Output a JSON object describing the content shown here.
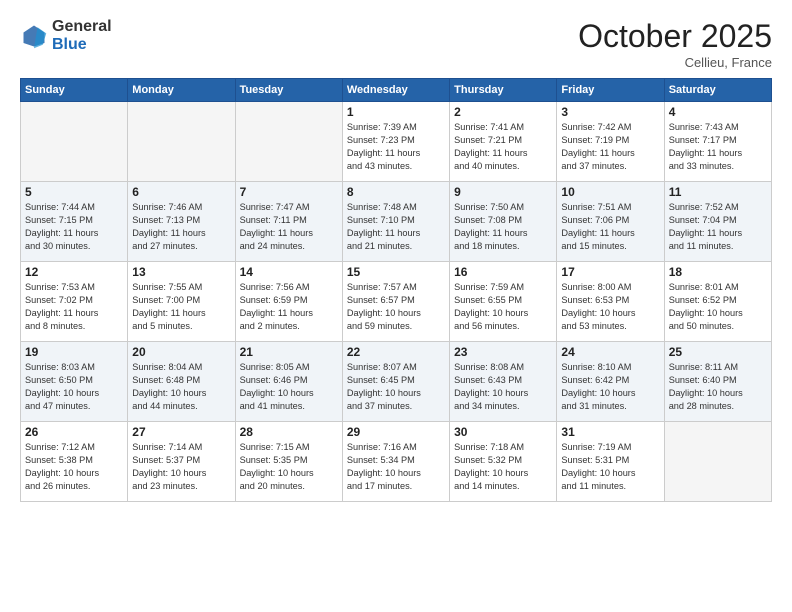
{
  "logo": {
    "general": "General",
    "blue": "Blue"
  },
  "title": "October 2025",
  "location": "Cellieu, France",
  "days_of_week": [
    "Sunday",
    "Monday",
    "Tuesday",
    "Wednesday",
    "Thursday",
    "Friday",
    "Saturday"
  ],
  "weeks": [
    [
      {
        "day": "",
        "info": ""
      },
      {
        "day": "",
        "info": ""
      },
      {
        "day": "",
        "info": ""
      },
      {
        "day": "1",
        "info": "Sunrise: 7:39 AM\nSunset: 7:23 PM\nDaylight: 11 hours\nand 43 minutes."
      },
      {
        "day": "2",
        "info": "Sunrise: 7:41 AM\nSunset: 7:21 PM\nDaylight: 11 hours\nand 40 minutes."
      },
      {
        "day": "3",
        "info": "Sunrise: 7:42 AM\nSunset: 7:19 PM\nDaylight: 11 hours\nand 37 minutes."
      },
      {
        "day": "4",
        "info": "Sunrise: 7:43 AM\nSunset: 7:17 PM\nDaylight: 11 hours\nand 33 minutes."
      }
    ],
    [
      {
        "day": "5",
        "info": "Sunrise: 7:44 AM\nSunset: 7:15 PM\nDaylight: 11 hours\nand 30 minutes."
      },
      {
        "day": "6",
        "info": "Sunrise: 7:46 AM\nSunset: 7:13 PM\nDaylight: 11 hours\nand 27 minutes."
      },
      {
        "day": "7",
        "info": "Sunrise: 7:47 AM\nSunset: 7:11 PM\nDaylight: 11 hours\nand 24 minutes."
      },
      {
        "day": "8",
        "info": "Sunrise: 7:48 AM\nSunset: 7:10 PM\nDaylight: 11 hours\nand 21 minutes."
      },
      {
        "day": "9",
        "info": "Sunrise: 7:50 AM\nSunset: 7:08 PM\nDaylight: 11 hours\nand 18 minutes."
      },
      {
        "day": "10",
        "info": "Sunrise: 7:51 AM\nSunset: 7:06 PM\nDaylight: 11 hours\nand 15 minutes."
      },
      {
        "day": "11",
        "info": "Sunrise: 7:52 AM\nSunset: 7:04 PM\nDaylight: 11 hours\nand 11 minutes."
      }
    ],
    [
      {
        "day": "12",
        "info": "Sunrise: 7:53 AM\nSunset: 7:02 PM\nDaylight: 11 hours\nand 8 minutes."
      },
      {
        "day": "13",
        "info": "Sunrise: 7:55 AM\nSunset: 7:00 PM\nDaylight: 11 hours\nand 5 minutes."
      },
      {
        "day": "14",
        "info": "Sunrise: 7:56 AM\nSunset: 6:59 PM\nDaylight: 11 hours\nand 2 minutes."
      },
      {
        "day": "15",
        "info": "Sunrise: 7:57 AM\nSunset: 6:57 PM\nDaylight: 10 hours\nand 59 minutes."
      },
      {
        "day": "16",
        "info": "Sunrise: 7:59 AM\nSunset: 6:55 PM\nDaylight: 10 hours\nand 56 minutes."
      },
      {
        "day": "17",
        "info": "Sunrise: 8:00 AM\nSunset: 6:53 PM\nDaylight: 10 hours\nand 53 minutes."
      },
      {
        "day": "18",
        "info": "Sunrise: 8:01 AM\nSunset: 6:52 PM\nDaylight: 10 hours\nand 50 minutes."
      }
    ],
    [
      {
        "day": "19",
        "info": "Sunrise: 8:03 AM\nSunset: 6:50 PM\nDaylight: 10 hours\nand 47 minutes."
      },
      {
        "day": "20",
        "info": "Sunrise: 8:04 AM\nSunset: 6:48 PM\nDaylight: 10 hours\nand 44 minutes."
      },
      {
        "day": "21",
        "info": "Sunrise: 8:05 AM\nSunset: 6:46 PM\nDaylight: 10 hours\nand 41 minutes."
      },
      {
        "day": "22",
        "info": "Sunrise: 8:07 AM\nSunset: 6:45 PM\nDaylight: 10 hours\nand 37 minutes."
      },
      {
        "day": "23",
        "info": "Sunrise: 8:08 AM\nSunset: 6:43 PM\nDaylight: 10 hours\nand 34 minutes."
      },
      {
        "day": "24",
        "info": "Sunrise: 8:10 AM\nSunset: 6:42 PM\nDaylight: 10 hours\nand 31 minutes."
      },
      {
        "day": "25",
        "info": "Sunrise: 8:11 AM\nSunset: 6:40 PM\nDaylight: 10 hours\nand 28 minutes."
      }
    ],
    [
      {
        "day": "26",
        "info": "Sunrise: 7:12 AM\nSunset: 5:38 PM\nDaylight: 10 hours\nand 26 minutes."
      },
      {
        "day": "27",
        "info": "Sunrise: 7:14 AM\nSunset: 5:37 PM\nDaylight: 10 hours\nand 23 minutes."
      },
      {
        "day": "28",
        "info": "Sunrise: 7:15 AM\nSunset: 5:35 PM\nDaylight: 10 hours\nand 20 minutes."
      },
      {
        "day": "29",
        "info": "Sunrise: 7:16 AM\nSunset: 5:34 PM\nDaylight: 10 hours\nand 17 minutes."
      },
      {
        "day": "30",
        "info": "Sunrise: 7:18 AM\nSunset: 5:32 PM\nDaylight: 10 hours\nand 14 minutes."
      },
      {
        "day": "31",
        "info": "Sunrise: 7:19 AM\nSunset: 5:31 PM\nDaylight: 10 hours\nand 11 minutes."
      },
      {
        "day": "",
        "info": ""
      }
    ]
  ]
}
